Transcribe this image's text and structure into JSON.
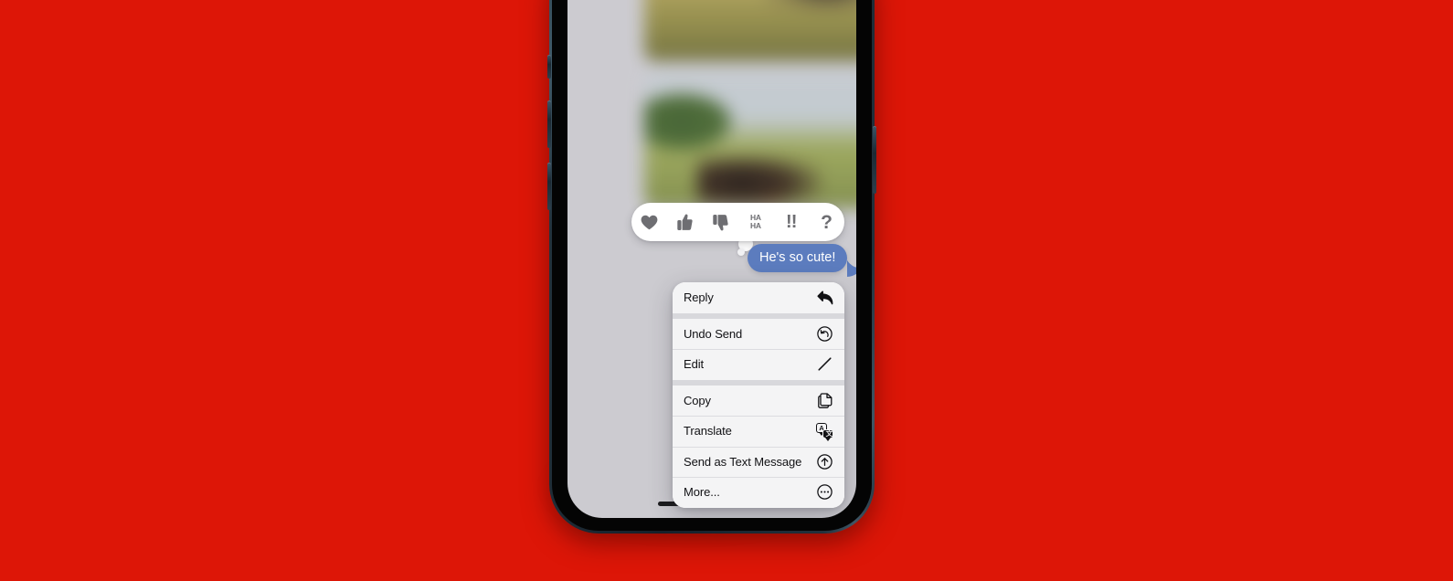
{
  "background": {
    "color": "#dd1607"
  },
  "device": {
    "name": "iPhone",
    "frame_color": "#22323d",
    "screen_bg": "#cccbd0",
    "buttons": [
      {
        "name": "mute-switch"
      },
      {
        "name": "volume-up-button"
      },
      {
        "name": "volume-down-button"
      },
      {
        "name": "power-button"
      }
    ],
    "home_indicator": true
  },
  "conversation": {
    "attachments": [
      {
        "name": "photo-attachment-1",
        "description": "blurred photo"
      },
      {
        "name": "photo-attachment-2",
        "description": "blurred photo"
      }
    ],
    "sent_message": {
      "text": "He's so cute!",
      "bubble_color": "#5c7cbe",
      "text_color": "#ffffff"
    }
  },
  "tapbacks": {
    "items": [
      {
        "icon": "heart-icon",
        "label": "Love"
      },
      {
        "icon": "thumbs-up-icon",
        "label": "Like"
      },
      {
        "icon": "thumbs-down-icon",
        "label": "Dislike"
      },
      {
        "icon": "haha-icon",
        "label": "HA\nHA",
        "line1": "HA",
        "line2": "HA"
      },
      {
        "icon": "exclamation-icon",
        "label": "!!"
      },
      {
        "icon": "question-icon",
        "label": "?"
      }
    ],
    "icon_color": "#6e6e72",
    "bar_color": "#ffffff"
  },
  "context_menu": {
    "bg_color": "#f4f4f5",
    "text_color": "#111114",
    "groups": [
      {
        "items": [
          {
            "label": "Reply",
            "icon": "reply-arrow-icon"
          }
        ]
      },
      {
        "items": [
          {
            "label": "Undo Send",
            "icon": "undo-circle-icon"
          },
          {
            "label": "Edit",
            "icon": "pencil-icon"
          }
        ]
      },
      {
        "items": [
          {
            "label": "Copy",
            "icon": "copy-icon"
          },
          {
            "label": "Translate",
            "icon": "translate-icon",
            "bubble1_char": "A",
            "bubble2_char": "文"
          },
          {
            "label": "Send as Text Message",
            "icon": "arrow-up-circle-icon"
          },
          {
            "label": "More...",
            "icon": "ellipsis-circle-icon"
          }
        ]
      }
    ]
  }
}
